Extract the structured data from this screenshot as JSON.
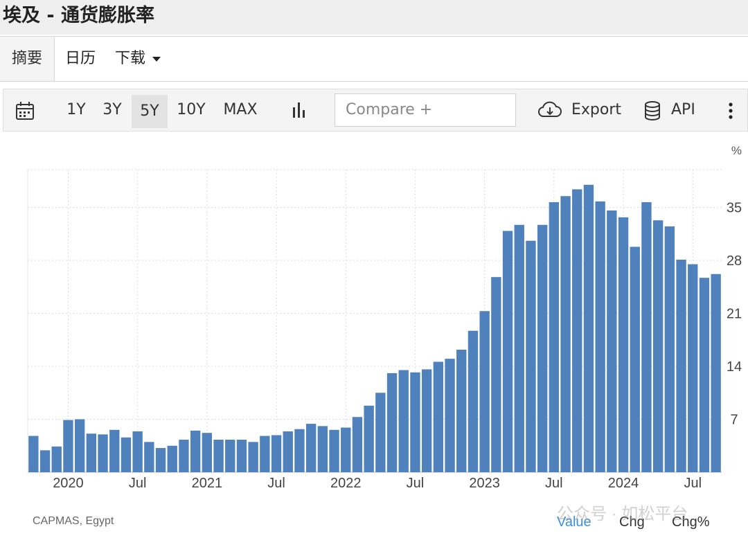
{
  "page": {
    "title": "埃及 - 通货膨胀率"
  },
  "tabs": [
    {
      "label": "摘要"
    },
    {
      "label": "日历"
    },
    {
      "label": "下载"
    }
  ],
  "toolbar": {
    "periods": [
      "1Y",
      "3Y",
      "5Y",
      "10Y",
      "MAX"
    ],
    "selected_period": "5Y",
    "compare_placeholder": "Compare +",
    "export_label": "Export",
    "api_label": "API",
    "icons": [
      "calendar-icon",
      "bar-chart-icon",
      "cloud-download-icon",
      "database-icon",
      "more-vertical-icon"
    ]
  },
  "footer": {
    "source": "CAPMAS, Egypt",
    "modes": [
      "Value",
      "Chg",
      "Chg%"
    ],
    "active_mode": "Value",
    "active_color": "#3b8fd9",
    "watermark": "公众号 · 如松平台"
  },
  "chart_data": {
    "type": "bar",
    "unit_label": "%",
    "color": "#4f81bd",
    "ylim": [
      0,
      40
    ],
    "yticks": [
      7,
      14,
      21,
      28,
      35
    ],
    "ytick_labels": [
      "7",
      "14",
      "21",
      "28",
      "35"
    ],
    "grid": true,
    "x_labels": [
      {
        "index": 3.5,
        "label": "2020"
      },
      {
        "index": 9.5,
        "label": "Jul"
      },
      {
        "index": 15.5,
        "label": "2021"
      },
      {
        "index": 21.5,
        "label": "Jul"
      },
      {
        "index": 27.5,
        "label": "2022"
      },
      {
        "index": 33.5,
        "label": "Jul"
      },
      {
        "index": 39.5,
        "label": "2023"
      },
      {
        "index": 45.5,
        "label": "Jul"
      },
      {
        "index": 51.5,
        "label": "2024"
      },
      {
        "index": 57.5,
        "label": "Jul"
      }
    ],
    "categories": [
      "2019-09",
      "2019-10",
      "2019-11",
      "2019-12",
      "2020-01",
      "2020-02",
      "2020-03",
      "2020-04",
      "2020-05",
      "2020-06",
      "2020-07",
      "2020-08",
      "2020-09",
      "2020-10",
      "2020-11",
      "2020-12",
      "2021-01",
      "2021-02",
      "2021-03",
      "2021-04",
      "2021-05",
      "2021-06",
      "2021-07",
      "2021-08",
      "2021-09",
      "2021-10",
      "2021-11",
      "2021-12",
      "2022-01",
      "2022-02",
      "2022-03",
      "2022-04",
      "2022-05",
      "2022-06",
      "2022-07",
      "2022-08",
      "2022-09",
      "2022-10",
      "2022-11",
      "2022-12",
      "2023-01",
      "2023-02",
      "2023-03",
      "2023-04",
      "2023-05",
      "2023-06",
      "2023-07",
      "2023-08",
      "2023-09",
      "2023-10",
      "2023-11",
      "2023-12",
      "2024-01",
      "2024-02",
      "2024-03",
      "2024-04",
      "2024-05",
      "2024-06",
      "2024-07",
      "2024-08"
    ],
    "values": [
      4.8,
      2.9,
      3.4,
      6.9,
      7.0,
      5.1,
      5.0,
      5.6,
      4.6,
      5.4,
      4.0,
      3.2,
      3.5,
      4.3,
      5.5,
      5.2,
      4.3,
      4.3,
      4.3,
      4.0,
      4.8,
      4.9,
      5.4,
      5.7,
      6.4,
      6.1,
      5.6,
      5.9,
      7.3,
      8.8,
      10.5,
      13.1,
      13.5,
      13.2,
      13.6,
      14.6,
      15.0,
      16.2,
      18.7,
      21.3,
      25.8,
      31.9,
      32.7,
      30.6,
      32.7,
      35.7,
      36.5,
      37.4,
      38.0,
      35.8,
      34.6,
      33.7,
      29.8,
      35.7,
      33.3,
      32.5,
      28.1,
      27.5,
      25.7,
      26.2
    ]
  }
}
